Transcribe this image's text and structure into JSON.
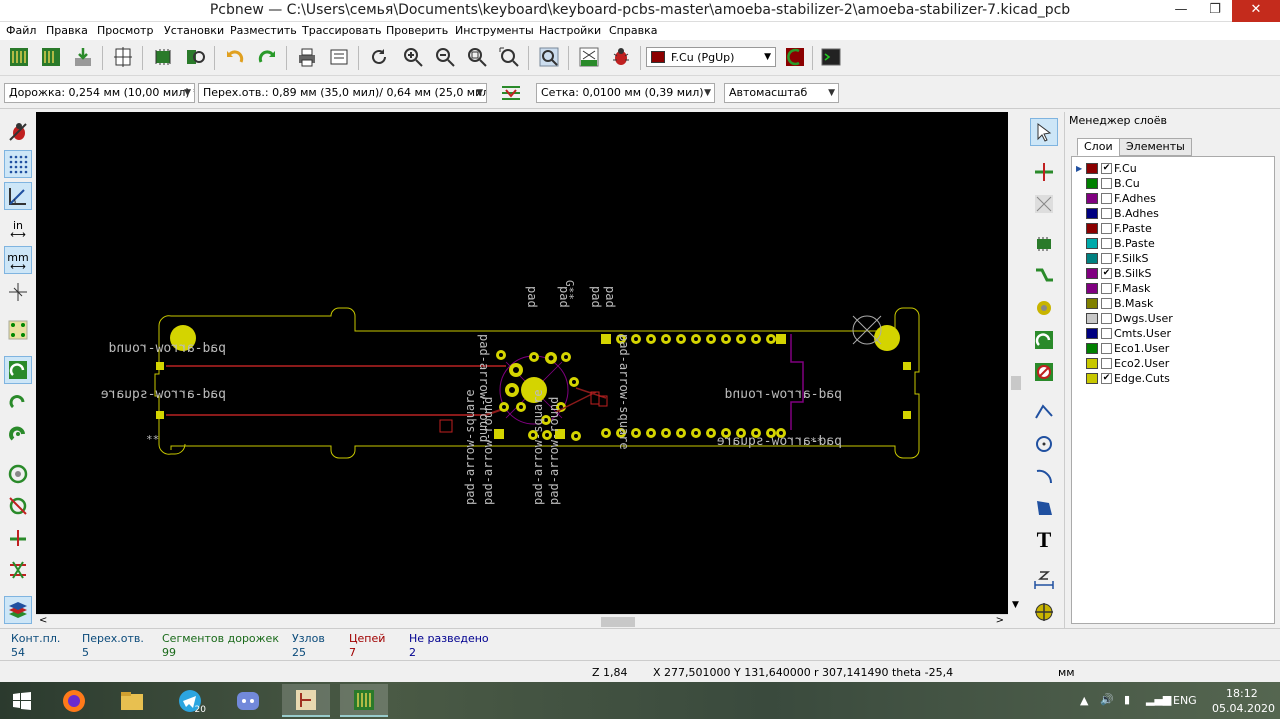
{
  "window": {
    "title": "Pcbnew — C:\\Users\\семья\\Documents\\keyboard\\keyboard-pcbs-master\\amoeba-stabilizer-2\\amoeba-stabilizer-7.kicad_pcb",
    "minimize": "—",
    "restore": "❐",
    "close": "✕"
  },
  "menu": [
    "Файл",
    "Правка",
    "Просмотр",
    "Установки",
    "Разместить",
    "Трассировать",
    "Проверить",
    "Инструменты",
    "Настройки",
    "Справка"
  ],
  "toolbar": {
    "active_layer": "F.Cu (PgUp)",
    "active_layer_color": "#8b0000"
  },
  "toolbar2": {
    "track": "Дорожка: 0,254 мм (10,00 мил) *",
    "via": "Перех.отв.: 0,89 мм (35,0 мил)/ 0,64 мм (25,0 мил) *",
    "grid": "Сетка: 0,0100 мм (0,39 мил)",
    "zoom": "Автомасштаб"
  },
  "left_toolbar": {
    "units_in": "in",
    "units_mm": "mm"
  },
  "right_toolbar": {
    "text_tool": "T"
  },
  "layer_manager": {
    "title": "Менеджер слоёв",
    "tabs": [
      "Слои",
      "Элементы"
    ],
    "layers": [
      {
        "name": "F.Cu",
        "color": "#8b0000",
        "checked": true,
        "active": true
      },
      {
        "name": "B.Cu",
        "color": "#008000",
        "checked": false
      },
      {
        "name": "F.Adhes",
        "color": "#800080",
        "checked": false
      },
      {
        "name": "B.Adhes",
        "color": "#000080",
        "checked": false
      },
      {
        "name": "F.Paste",
        "color": "#8b0000",
        "checked": false
      },
      {
        "name": "B.Paste",
        "color": "#00aaaa",
        "checked": false
      },
      {
        "name": "F.SilkS",
        "color": "#008080",
        "checked": false
      },
      {
        "name": "B.SilkS",
        "color": "#800080",
        "checked": true
      },
      {
        "name": "F.Mask",
        "color": "#800080",
        "checked": false
      },
      {
        "name": "B.Mask",
        "color": "#808000",
        "checked": false
      },
      {
        "name": "Dwgs.User",
        "color": "#c8c8c8",
        "checked": false
      },
      {
        "name": "Cmts.User",
        "color": "#000080",
        "checked": false
      },
      {
        "name": "Eco1.User",
        "color": "#008000",
        "checked": false
      },
      {
        "name": "Eco2.User",
        "color": "#c8c800",
        "checked": false
      },
      {
        "name": "Edge.Cuts",
        "color": "#c8c800",
        "checked": true
      }
    ]
  },
  "messages": [
    {
      "label": "Конт.пл.",
      "value": "54",
      "color": "#0a4a7a"
    },
    {
      "label": "Перех.отв.",
      "value": "5",
      "color": "#0a4a7a"
    },
    {
      "label": "Сегментов дорожек",
      "value": "99",
      "color": "#1a6a1a"
    },
    {
      "label": "Узлов",
      "value": "25",
      "color": "#0a4a7a"
    },
    {
      "label": "Цепей",
      "value": "7",
      "color": "#a00000"
    },
    {
      "label": "Не разведено",
      "value": "2",
      "color": "#000090"
    }
  ],
  "status": {
    "zoom": "Z 1,84",
    "xy": "X 277,501000  Y 131,640000",
    "polar": "r 307,141490  theta -25,4",
    "units": "мм"
  },
  "pcb_labels": {
    "round": "pad-arrow-round",
    "square": "pad-arrow-square",
    "ref": "**",
    "pad": "pad",
    "g": "G**"
  },
  "taskbar": {
    "lang": "ENG",
    "time": "18:12",
    "date": "05.04.2020",
    "telegram_badge": "20"
  }
}
